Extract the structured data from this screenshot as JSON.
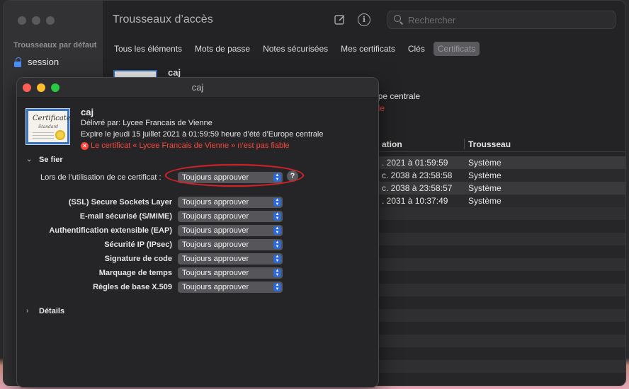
{
  "keychain_window": {
    "title": "Trousseaux d’accès",
    "sidebar": {
      "heading": "Trousseaux par défaut",
      "items": [
        {
          "label": "session",
          "icon": "lock-icon"
        }
      ]
    },
    "search": {
      "placeholder": "Rechercher"
    },
    "tabs": [
      {
        "label": "Tous les éléments",
        "active": false
      },
      {
        "label": "Mots de passe",
        "active": false
      },
      {
        "label": "Notes sécurisées",
        "active": false
      },
      {
        "label": "Mes certificats",
        "active": false
      },
      {
        "label": "Clés",
        "active": false
      },
      {
        "label": "Certificats",
        "active": true
      }
    ],
    "detail": {
      "name": "caj",
      "expiry_fragment": "ope centrale",
      "untrusted_fragment": "ble"
    },
    "table": {
      "columns": [
        {
          "label": "ation"
        },
        {
          "label": "Trousseau"
        }
      ],
      "rows": [
        {
          "expiration": ". 2021 à 01:59:59",
          "keychain": "Système"
        },
        {
          "expiration": "c. 2038 à 23:58:58",
          "keychain": "Système"
        },
        {
          "expiration": "c. 2038 à 23:58:57",
          "keychain": "Système"
        },
        {
          "expiration": ". 2031 à 10:37:49",
          "keychain": "Système"
        }
      ]
    }
  },
  "dialog": {
    "title": "caj",
    "certificate": {
      "icon_text": "Certificate",
      "icon_subtext": "Standard",
      "name": "caj",
      "issued_by": "Délivré par: Lycee Francais de Vienne",
      "expires": "Expire le jeudi 15 juillet 2021 à 01:59:59 heure d’été d’Europe centrale",
      "warning": "Le certificat « Lycee Francais de Vienne » n’est pas fiable"
    },
    "trust_section": {
      "label": "Se fier",
      "when_using_label": "Lors de l’utilisation de ce certificat :",
      "when_using_value": "Toujours approuver",
      "policies": [
        {
          "label": "(SSL) Secure Sockets Layer",
          "value": "Toujours approuver"
        },
        {
          "label": "E-mail sécurisé (S/MIME)",
          "value": "Toujours approuver"
        },
        {
          "label": "Authentification extensible (EAP)",
          "value": "Toujours approuver"
        },
        {
          "label": "Sécurité IP (IPsec)",
          "value": "Toujours approuver"
        },
        {
          "label": "Signature de code",
          "value": "Toujours approuver"
        },
        {
          "label": "Marquage de temps",
          "value": "Toujours approuver"
        },
        {
          "label": "Règles de base X.509",
          "value": "Toujours approuver"
        }
      ]
    },
    "details_section": {
      "label": "Détails"
    },
    "help_label": "?"
  },
  "colors": {
    "close": "#ff5f57",
    "minimize": "#febc2e",
    "zoom": "#28c840",
    "warning": "#ff453a",
    "accent": "#2d6ad6",
    "highlight": "#d3232a"
  }
}
